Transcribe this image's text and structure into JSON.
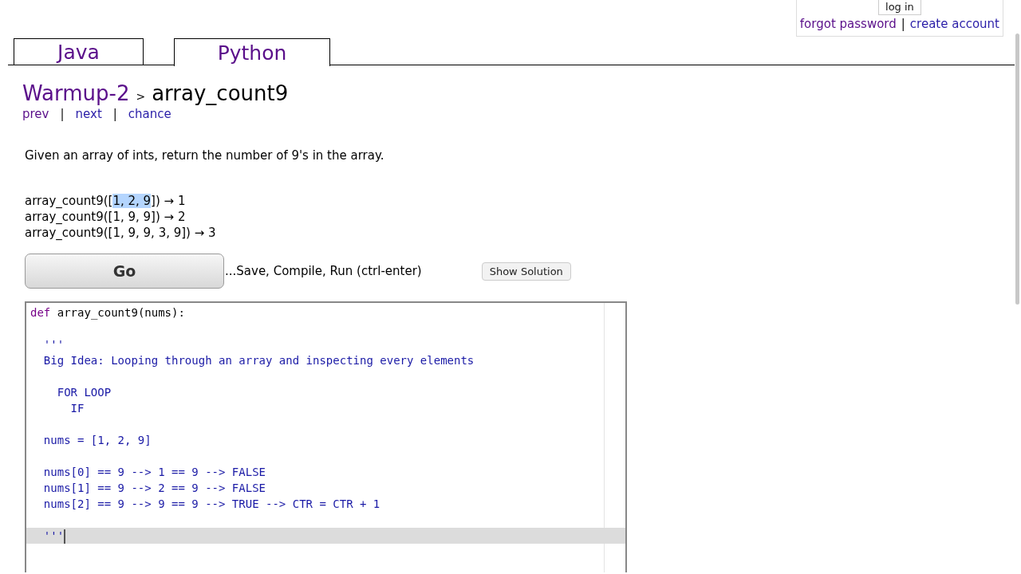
{
  "login": {
    "button": "log in",
    "links": [
      {
        "label": "forgot password",
        "visited": true
      },
      {
        "label": "create account",
        "visited": false
      }
    ],
    "separator": "|"
  },
  "tabs": [
    {
      "label": "Java",
      "selected": false
    },
    {
      "label": "Python",
      "selected": true
    }
  ],
  "breadcrumb": {
    "parent": "Warmup-2",
    "separator": ">",
    "title": "array_count9"
  },
  "nav": {
    "links": [
      {
        "label": "prev",
        "visited": true
      },
      {
        "label": "next",
        "visited": false
      },
      {
        "label": "chance",
        "visited": false
      }
    ],
    "separator": "|"
  },
  "description": "Given an array of ints, return the number of 9's in the array.",
  "examples": [
    {
      "before": "array_count9([",
      "selection": "1, 2, 9",
      "after": "]) → 1"
    },
    {
      "before": "array_count9([1, 9, 9]) → 2"
    },
    {
      "before": "array_count9([1, 9, 9, 3, 9]) → 3"
    }
  ],
  "go_button": "Go",
  "go_hint": "...Save, Compile, Run (ctrl-enter)",
  "solution_button": "Show Solution",
  "editor": {
    "lines": [
      {
        "kind": "def",
        "keyword": "def",
        "text": "array_count9(nums):",
        "current": false
      },
      {
        "kind": "blank"
      },
      {
        "kind": "string",
        "text": "  '''",
        "current": false
      },
      {
        "kind": "string",
        "text": "  Big Idea: Looping through an array and inspecting every elements",
        "current": false
      },
      {
        "kind": "blank"
      },
      {
        "kind": "string",
        "text": "    FOR LOOP",
        "current": false
      },
      {
        "kind": "string",
        "text": "      IF",
        "current": false
      },
      {
        "kind": "blank"
      },
      {
        "kind": "string",
        "text": "  nums = [1, 2, 9]",
        "current": false
      },
      {
        "kind": "blank"
      },
      {
        "kind": "string",
        "text": "  nums[0] == 9 --> 1 == 9 --> FALSE",
        "current": false
      },
      {
        "kind": "string",
        "text": "  nums[1] == 9 --> 2 == 9 --> FALSE",
        "current": false
      },
      {
        "kind": "string",
        "text": "  nums[2] == 9 --> 9 == 9 --> TRUE --> CTR = CTR + 1",
        "current": false
      },
      {
        "kind": "blank"
      },
      {
        "kind": "string",
        "text": "  '''",
        "current": true
      }
    ]
  }
}
